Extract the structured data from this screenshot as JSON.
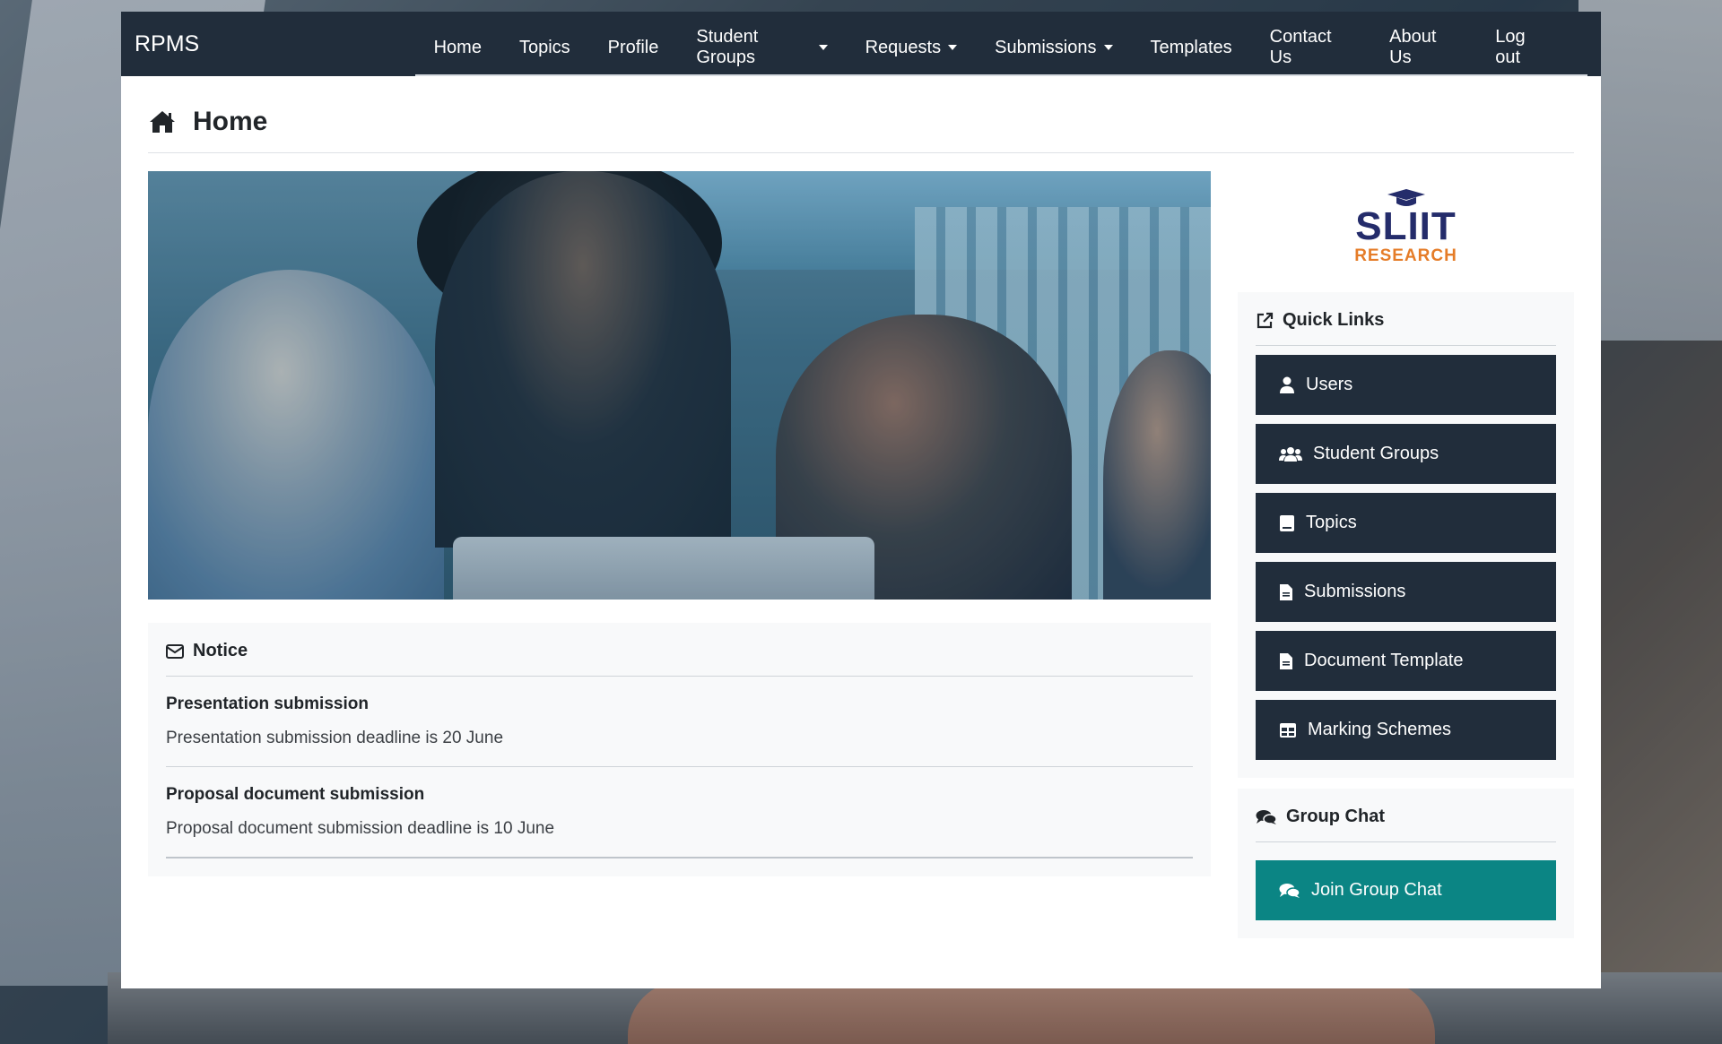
{
  "nav": {
    "brand": "RPMS",
    "items": [
      {
        "label": "Home",
        "dropdown": false
      },
      {
        "label": "Topics",
        "dropdown": false
      },
      {
        "label": "Profile",
        "dropdown": false
      },
      {
        "label": "Student Groups",
        "dropdown": true
      },
      {
        "label": "Requests",
        "dropdown": true
      },
      {
        "label": "Submissions",
        "dropdown": true
      },
      {
        "label": "Templates",
        "dropdown": false
      },
      {
        "label": "Contact Us",
        "dropdown": false
      },
      {
        "label": "About Us",
        "dropdown": false
      },
      {
        "label": "Log out",
        "dropdown": false
      }
    ]
  },
  "page": {
    "title": "Home"
  },
  "notice": {
    "title": "Notice",
    "items": [
      {
        "title": "Presentation submission",
        "text": "Presentation submission deadline is 20 June"
      },
      {
        "title": "Proposal document submission",
        "text": "Proposal document submission deadline is 10 June"
      }
    ]
  },
  "logo": {
    "main": "SLIIT",
    "sub": "RESEARCH"
  },
  "quick_links": {
    "title": "Quick Links",
    "items": [
      {
        "label": "Users",
        "icon": "user-icon"
      },
      {
        "label": "Student Groups",
        "icon": "users-icon"
      },
      {
        "label": "Topics",
        "icon": "book-icon"
      },
      {
        "label": "Submissions",
        "icon": "file-icon"
      },
      {
        "label": "Document Template",
        "icon": "file-icon"
      },
      {
        "label": "Marking Schemes",
        "icon": "table-icon"
      }
    ]
  },
  "group_chat": {
    "title": "Group Chat",
    "button": "Join Group Chat"
  },
  "colors": {
    "navbar": "#212d3b",
    "chat_button": "#0b8584",
    "logo_blue": "#242c6b",
    "logo_orange": "#e57c28"
  }
}
